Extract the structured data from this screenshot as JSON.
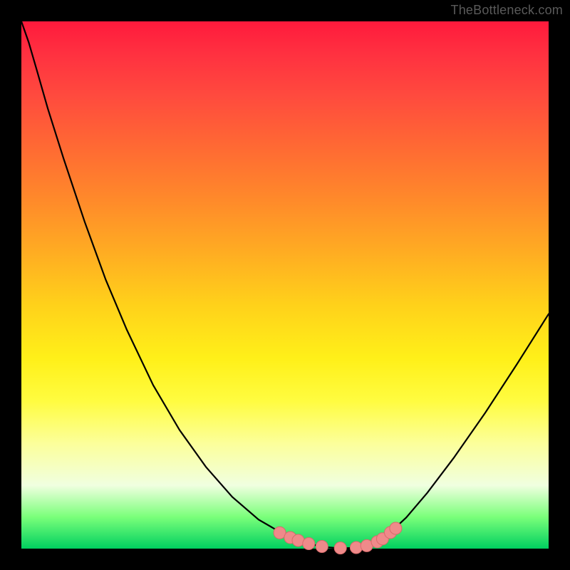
{
  "watermark": "TheBottleneck.com",
  "colors": {
    "frame": "#000000",
    "curve": "#000000",
    "marker_fill": "#ef8a8a",
    "marker_stroke": "#d86b6b"
  },
  "chart_data": {
    "type": "line",
    "title": "",
    "xlabel": "",
    "ylabel": "",
    "xlim": [
      0,
      100
    ],
    "ylim": [
      0,
      100
    ],
    "series": [
      {
        "name": "bottleneck-curve",
        "x": [
          0,
          1.4,
          3,
          5,
          8,
          12,
          16,
          20,
          25,
          30,
          35,
          40,
          45,
          50,
          53,
          56,
          58,
          60,
          62,
          64,
          66,
          68,
          70,
          73,
          77,
          82,
          88,
          94,
          100
        ],
        "y": [
          100,
          96,
          90.5,
          83.5,
          74,
          62,
          51,
          41.5,
          31,
          22.5,
          15.5,
          9.8,
          5.5,
          2.6,
          1.4,
          0.6,
          0.25,
          0.1,
          0.1,
          0.25,
          0.7,
          1.6,
          3.1,
          5.9,
          10.6,
          17.2,
          25.8,
          35,
          44.5
        ]
      }
    ],
    "markers": [
      {
        "x": 49.0,
        "y": 3.0
      },
      {
        "x": 51.0,
        "y": 2.1
      },
      {
        "x": 52.5,
        "y": 1.55
      },
      {
        "x": 54.5,
        "y": 0.95
      },
      {
        "x": 57.0,
        "y": 0.4
      },
      {
        "x": 60.5,
        "y": 0.12
      },
      {
        "x": 63.5,
        "y": 0.2
      },
      {
        "x": 65.5,
        "y": 0.55
      },
      {
        "x": 67.5,
        "y": 1.3
      },
      {
        "x": 68.5,
        "y": 1.85
      },
      {
        "x": 70.0,
        "y": 3.05
      },
      {
        "x": 71.0,
        "y": 3.85
      }
    ]
  }
}
